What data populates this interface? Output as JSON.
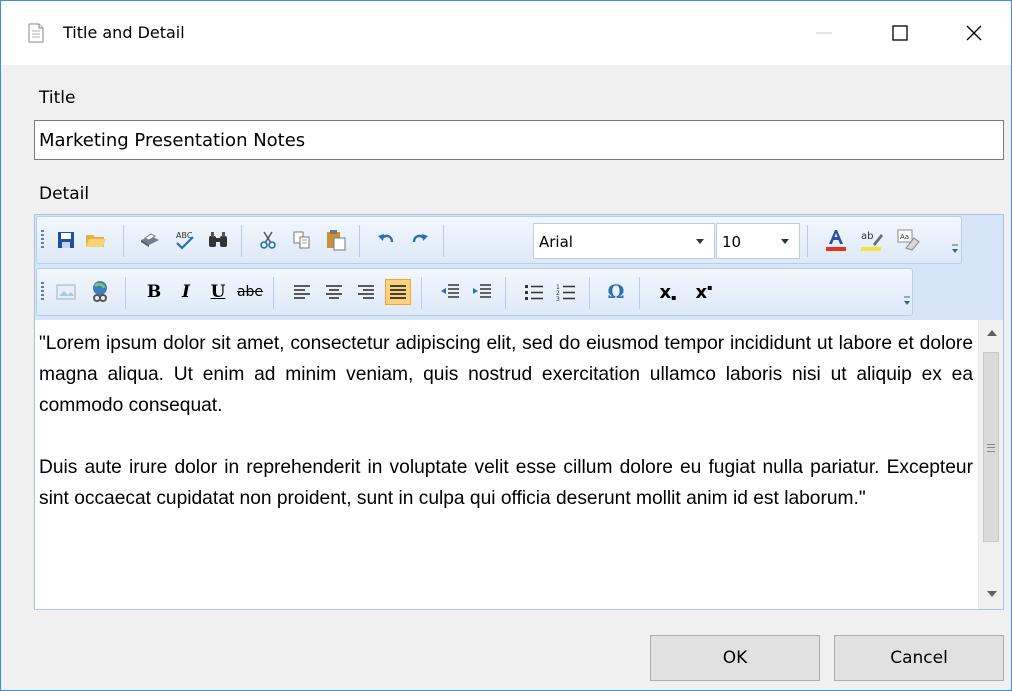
{
  "window": {
    "title": "Title and Detail"
  },
  "form": {
    "title_label": "Title",
    "title_value": "Marketing Presentation Notes",
    "detail_label": "Detail"
  },
  "toolbar": {
    "font_name": "Arial",
    "font_size": "10",
    "bold_glyph": "B",
    "italic_glyph": "I",
    "underline_glyph": "U",
    "strike_glyph": "abe",
    "omega_glyph": "Ω",
    "subscript_glyph": "x",
    "superscript_glyph": "x"
  },
  "editor": {
    "paragraph1": "\"Lorem ipsum dolor sit amet, consectetur adipiscing elit, sed do eiusmod tempor incididunt ut labore et dolore magna aliqua. Ut enim ad minim veniam, quis nostrud exercitation ullamco laboris nisi ut aliquip ex ea commodo consequat.",
    "paragraph2": "Duis aute irure dolor in reprehenderit in voluptate velit esse cillum dolore eu fugiat nulla pariatur. Excepteur sint occaecat cupidatat non proident, sunt in culpa qui officia deserunt mollit anim id est laborum.\""
  },
  "buttons": {
    "ok": "OK",
    "cancel": "Cancel"
  },
  "colors": {
    "accent_border": "#3c8ed8",
    "toolbar_bg": "#d6e5f7",
    "active_highlight": "#fbd17a"
  }
}
